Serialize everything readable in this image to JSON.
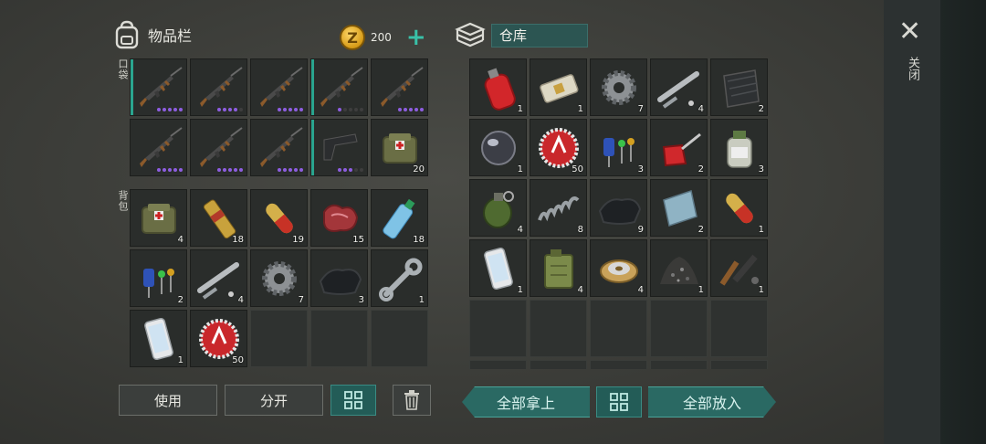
{
  "inventory": {
    "title": "物品栏",
    "coins": "200",
    "coin_symbol": "Z",
    "pocket_label": "口袋",
    "backpack_label": "背包",
    "pocket": [
      {
        "icon": "ak-rifle-icon",
        "count": "",
        "dots": 5,
        "dots_on": 5
      },
      {
        "icon": "ak-rifle-icon",
        "count": "",
        "dots": 5,
        "dots_on": 4
      },
      {
        "icon": "ak-rifle-icon",
        "count": "",
        "dots": 5,
        "dots_on": 5
      },
      {
        "icon": "ak-rifle-icon",
        "count": "",
        "dots": 5,
        "dots_on": 1
      },
      {
        "icon": "ak-rifle-icon",
        "count": "",
        "dots": 5,
        "dots_on": 5
      },
      {
        "icon": "ak-rifle-icon",
        "count": "",
        "dots": 5,
        "dots_on": 5
      },
      {
        "icon": "ak-rifle-icon",
        "count": "",
        "dots": 5,
        "dots_on": 5
      },
      {
        "icon": "ak-rifle-icon",
        "count": "",
        "dots": 5,
        "dots_on": 5
      },
      {
        "icon": "pistol-icon",
        "count": "",
        "dots": 5,
        "dots_on": 3
      },
      {
        "icon": "medkit-bag-icon",
        "count": "20",
        "dots": 0,
        "dots_on": 0
      }
    ],
    "backpack": [
      {
        "icon": "medkit-bag-icon",
        "count": "4"
      },
      {
        "icon": "bandage-roll-icon",
        "count": "18"
      },
      {
        "icon": "pill-capsule-icon",
        "count": "19"
      },
      {
        "icon": "raw-meat-icon",
        "count": "15"
      },
      {
        "icon": "water-bottle-icon",
        "count": "18"
      },
      {
        "icon": "electronic-parts-icon",
        "count": "2"
      },
      {
        "icon": "pipe-parts-icon",
        "count": "4"
      },
      {
        "icon": "gear-icon",
        "count": "7"
      },
      {
        "icon": "cloth-icon",
        "count": "3"
      },
      {
        "icon": "wrench-icon",
        "count": "1"
      },
      {
        "icon": "smartphone-icon",
        "count": "1"
      },
      {
        "icon": "bottle-cap-icon",
        "count": "50"
      },
      {
        "icon": "",
        "count": ""
      },
      {
        "icon": "",
        "count": ""
      },
      {
        "icon": "",
        "count": ""
      }
    ],
    "buttons": {
      "use": "使用",
      "split": "分开"
    }
  },
  "storage": {
    "name": "仓库",
    "items": [
      {
        "icon": "gas-canister-icon",
        "count": "1"
      },
      {
        "icon": "eraser-icon",
        "count": "1"
      },
      {
        "icon": "gear-icon",
        "count": "7"
      },
      {
        "icon": "pipe-parts-icon",
        "count": "4"
      },
      {
        "icon": "rubber-sheet-icon",
        "count": "2"
      },
      {
        "icon": "lens-icon",
        "count": "1"
      },
      {
        "icon": "bottle-cap-icon",
        "count": "50"
      },
      {
        "icon": "electronic-parts-icon",
        "count": "3"
      },
      {
        "icon": "oil-can-icon",
        "count": "2"
      },
      {
        "icon": "chemical-jar-icon",
        "count": "3"
      },
      {
        "icon": "grenade-icon",
        "count": "4"
      },
      {
        "icon": "spring-icon",
        "count": "8"
      },
      {
        "icon": "cloth-icon",
        "count": "9"
      },
      {
        "icon": "metal-plate-icon",
        "count": "2"
      },
      {
        "icon": "pill-capsule-icon",
        "count": "1"
      },
      {
        "icon": "smartphone-icon",
        "count": "1"
      },
      {
        "icon": "jerrycan-icon",
        "count": "4"
      },
      {
        "icon": "wire-spool-icon",
        "count": "4"
      },
      {
        "icon": "gravel-pile-icon",
        "count": "1"
      },
      {
        "icon": "gun-parts-icon",
        "count": "1"
      },
      {
        "icon": "",
        "count": ""
      },
      {
        "icon": "",
        "count": ""
      },
      {
        "icon": "",
        "count": ""
      },
      {
        "icon": "",
        "count": ""
      },
      {
        "icon": "",
        "count": ""
      },
      {
        "icon": "",
        "count": ""
      },
      {
        "icon": "",
        "count": ""
      },
      {
        "icon": "",
        "count": ""
      },
      {
        "icon": "",
        "count": ""
      },
      {
        "icon": "",
        "count": ""
      }
    ],
    "buttons": {
      "take_all": "全部拿上",
      "put_all": "全部放入"
    }
  },
  "close_label": "关闭",
  "colors": {
    "accent": "#2aa58f",
    "durability": "#8e5ee0",
    "button_teal": "#235c57"
  }
}
